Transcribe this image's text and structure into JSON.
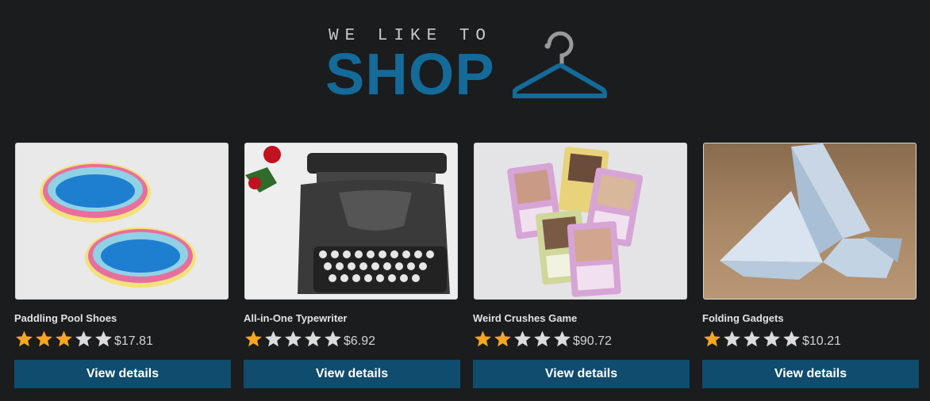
{
  "header": {
    "tagline": "WE LIKE TO",
    "brand_word": "SHOP",
    "brand_color": "#146a98",
    "icon": "hanger-icon"
  },
  "colors": {
    "background": "#1b1c1e",
    "button": "#0f4c6e",
    "star_filled": "#f5a623",
    "star_empty": "#dcdcdc"
  },
  "products": [
    {
      "name": "Paddling Pool Shoes",
      "rating": 3,
      "max_rating": 5,
      "price": "$17.81",
      "button_label": "View details",
      "image": "paddling-pools-image"
    },
    {
      "name": "All-in-One Typewriter",
      "rating": 1,
      "max_rating": 5,
      "price": "$6.92",
      "button_label": "View details",
      "image": "typewriter-image"
    },
    {
      "name": "Weird Crushes Game",
      "rating": 2,
      "max_rating": 5,
      "price": "$90.72",
      "button_label": "View details",
      "image": "trading-cards-image"
    },
    {
      "name": "Folding Gadgets",
      "rating": 1,
      "max_rating": 5,
      "price": "$10.21",
      "button_label": "View details",
      "image": "origami-bird-image"
    }
  ]
}
